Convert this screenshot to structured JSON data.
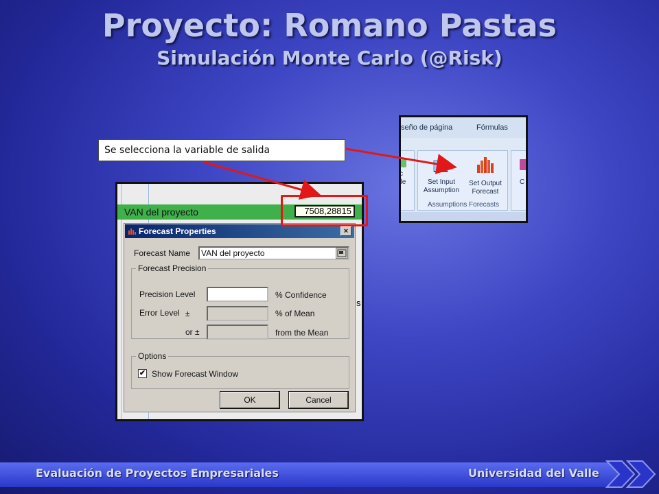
{
  "slide": {
    "title": "Proyecto: Romano Pastas",
    "subtitle": "Simulación Monte Carlo (@Risk)",
    "callout": "Se selecciona la variable de salida"
  },
  "ribbon": {
    "tabs": [
      "seño de página",
      "Fórmulas"
    ],
    "left_group_label": "ble",
    "left_group_label_top": "c",
    "buttons": [
      {
        "line1": "Set Input",
        "line2": "Assumption",
        "icon": "set-input-icon"
      },
      {
        "line1": "Set Output",
        "line2": "Forecast",
        "icon": "set-output-icon"
      }
    ],
    "right_group_label": "C",
    "group_title": "Assumptions Forecasts"
  },
  "excel": {
    "row_label": "VAN del proyecto",
    "cell_value": "7508,28815",
    "side_char": "s"
  },
  "dialog": {
    "title": "Forecast Properties",
    "close": "×",
    "forecast_name_label": "Forecast Name",
    "forecast_name_value": "VAN del proyecto",
    "precision_group": "Forecast Precision",
    "precision_level_label": "Precision Level",
    "precision_level_value": "",
    "precision_level_unit": "% Confidence",
    "error_level_label": "Error Level",
    "error_pm": "±",
    "error_unit": "% of Mean",
    "or_label": "or ±",
    "or_unit": "from the Mean",
    "options_group": "Options",
    "show_window_label": "Show Forecast Window",
    "show_window_checked": "✔",
    "ok": "OK",
    "cancel": "Cancel"
  },
  "footer": {
    "left": "Evaluación de Proyectos Empresariales",
    "right": "Universidad del Valle"
  },
  "colors": {
    "arrow": "#e01818",
    "excel_row": "#3fb04a",
    "dialog_title": "#0a246a"
  }
}
